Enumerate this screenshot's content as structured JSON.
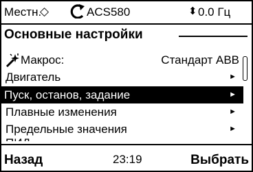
{
  "status_bar": {
    "location": "Местн.",
    "location_symbol": "◇",
    "drive_name": "ACS580",
    "frequency_icon": "up-down-arrows-icon",
    "frequency": "0.0 Гц"
  },
  "menu": {
    "title": "Основные настройки",
    "items": [
      {
        "label": "Макрос:",
        "value": "Стандарт ABB",
        "icon": "macro-icon"
      },
      {
        "label": "Двигатель",
        "arrow": "►"
      },
      {
        "label": "Пуск, останов, задание",
        "arrow": "►",
        "selected": true
      },
      {
        "label": "Плавные изменения",
        "arrow": "►"
      },
      {
        "label": "Предельные значения",
        "arrow": "►"
      }
    ],
    "partial_item": "ПИД"
  },
  "bottom_bar": {
    "back_label": "Назад",
    "time": "23:19",
    "select_label": "Выбрать"
  }
}
